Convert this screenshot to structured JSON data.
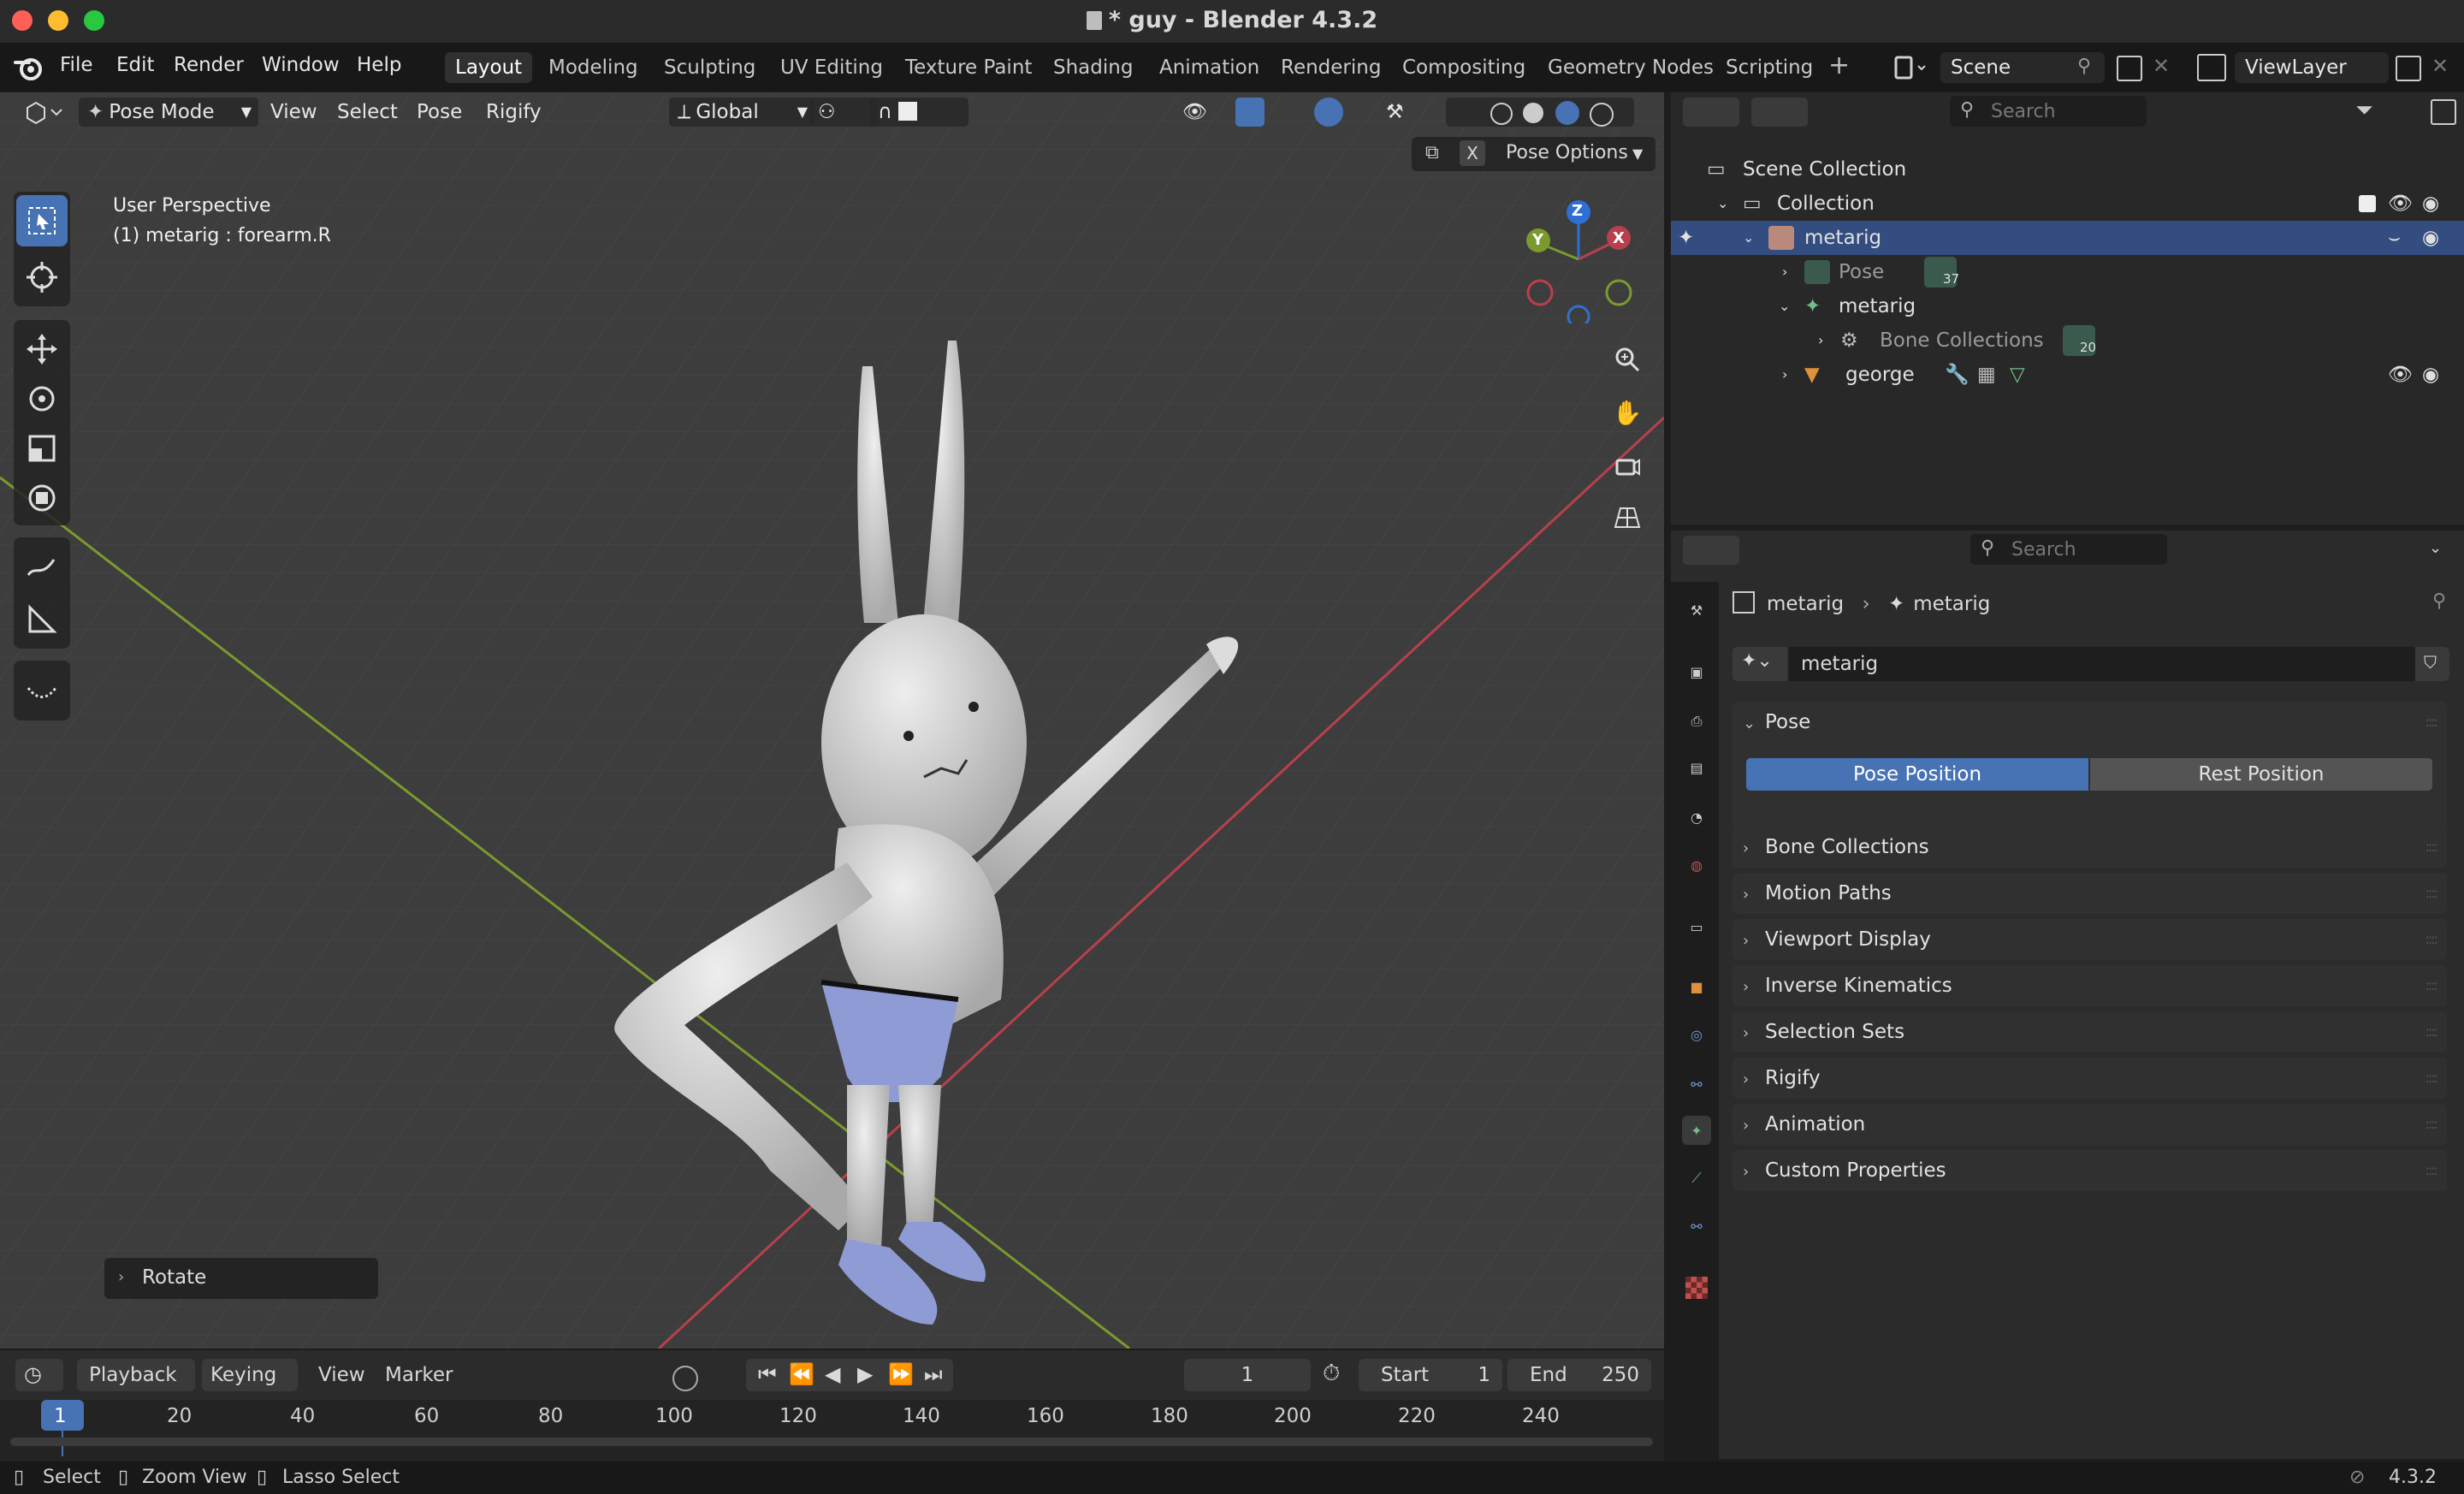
{
  "window": {
    "title": "* guy - Blender 4.3.2"
  },
  "menu": [
    "File",
    "Edit",
    "Render",
    "Window",
    "Help"
  ],
  "workspaces": [
    "Layout",
    "Modeling",
    "Sculpting",
    "UV Editing",
    "Texture Paint",
    "Shading",
    "Animation",
    "Rendering",
    "Compositing",
    "Geometry Nodes",
    "Scripting"
  ],
  "active_workspace": "Layout",
  "scene": {
    "name": "Scene",
    "view_layer": "ViewLayer"
  },
  "viewport": {
    "mode": "Pose Mode",
    "header_menus": [
      "View",
      "Select",
      "Pose",
      "Rigify"
    ],
    "transform_orientation": "Global",
    "view_name": "User Perspective",
    "active_info": "(1) metarig : forearm.R",
    "pose_options": "Pose Options",
    "x_mirror": "X",
    "last_operator": "Rotate",
    "gizmo_axes": {
      "x": "X",
      "y": "Y",
      "z": "Z"
    },
    "colors": {
      "x_axis": "#b8404d",
      "y_axis": "#7a9a2e",
      "z_axis": "#2e6fd6",
      "active_tool": "#4772b3"
    }
  },
  "timeline": {
    "menus": [
      "Playback",
      "Keying",
      "View",
      "Marker"
    ],
    "current_frame": "1",
    "start_label": "Start",
    "start": "1",
    "end_label": "End",
    "end": "250",
    "ticks": [
      "1",
      "20",
      "40",
      "60",
      "80",
      "100",
      "120",
      "140",
      "160",
      "180",
      "200",
      "220",
      "240"
    ]
  },
  "statusbar": {
    "items": [
      "Select",
      "Zoom View",
      "Lasso Select"
    ],
    "version": "4.3.2"
  },
  "outliner": {
    "search_placeholder": "Search",
    "rows": {
      "scene_collection": "Scene Collection",
      "collection": "Collection",
      "metarig_object": "metarig",
      "pose": "Pose",
      "pose_count": "37",
      "metarig_data": "metarig",
      "bone_collections": "Bone Collections",
      "bone_collections_count": "20",
      "george": "george"
    }
  },
  "properties": {
    "search_placeholder": "Search",
    "breadcrumb": [
      "metarig",
      "metarig"
    ],
    "data_name": "metarig",
    "pose_panel": "Pose",
    "pose_position": "Pose Position",
    "rest_position": "Rest Position",
    "panels": [
      "Bone Collections",
      "Motion Paths",
      "Viewport Display",
      "Inverse Kinematics",
      "Selection Sets",
      "Rigify",
      "Animation",
      "Custom Properties"
    ]
  }
}
